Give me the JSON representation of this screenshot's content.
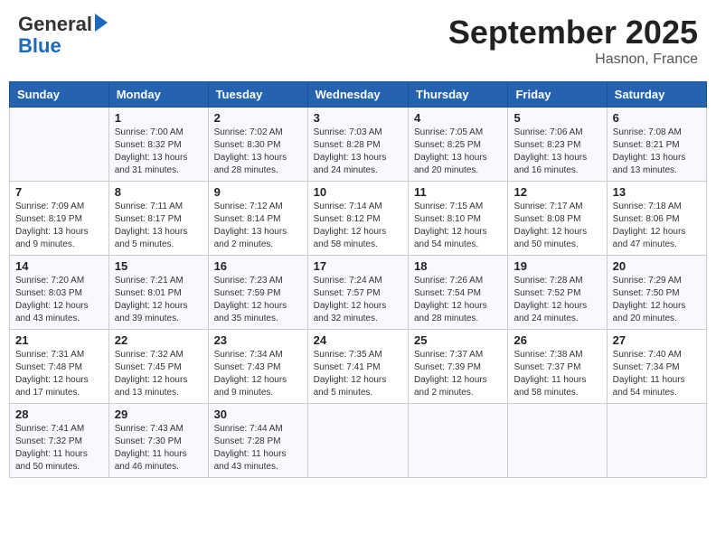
{
  "header": {
    "logo_line1": "General",
    "logo_line2": "Blue",
    "month": "September 2025",
    "location": "Hasnon, France"
  },
  "weekdays": [
    "Sunday",
    "Monday",
    "Tuesday",
    "Wednesday",
    "Thursday",
    "Friday",
    "Saturday"
  ],
  "weeks": [
    [
      {
        "day": "",
        "info": ""
      },
      {
        "day": "1",
        "info": "Sunrise: 7:00 AM\nSunset: 8:32 PM\nDaylight: 13 hours\nand 31 minutes."
      },
      {
        "day": "2",
        "info": "Sunrise: 7:02 AM\nSunset: 8:30 PM\nDaylight: 13 hours\nand 28 minutes."
      },
      {
        "day": "3",
        "info": "Sunrise: 7:03 AM\nSunset: 8:28 PM\nDaylight: 13 hours\nand 24 minutes."
      },
      {
        "day": "4",
        "info": "Sunrise: 7:05 AM\nSunset: 8:25 PM\nDaylight: 13 hours\nand 20 minutes."
      },
      {
        "day": "5",
        "info": "Sunrise: 7:06 AM\nSunset: 8:23 PM\nDaylight: 13 hours\nand 16 minutes."
      },
      {
        "day": "6",
        "info": "Sunrise: 7:08 AM\nSunset: 8:21 PM\nDaylight: 13 hours\nand 13 minutes."
      }
    ],
    [
      {
        "day": "7",
        "info": "Sunrise: 7:09 AM\nSunset: 8:19 PM\nDaylight: 13 hours\nand 9 minutes."
      },
      {
        "day": "8",
        "info": "Sunrise: 7:11 AM\nSunset: 8:17 PM\nDaylight: 13 hours\nand 5 minutes."
      },
      {
        "day": "9",
        "info": "Sunrise: 7:12 AM\nSunset: 8:14 PM\nDaylight: 13 hours\nand 2 minutes."
      },
      {
        "day": "10",
        "info": "Sunrise: 7:14 AM\nSunset: 8:12 PM\nDaylight: 12 hours\nand 58 minutes."
      },
      {
        "day": "11",
        "info": "Sunrise: 7:15 AM\nSunset: 8:10 PM\nDaylight: 12 hours\nand 54 minutes."
      },
      {
        "day": "12",
        "info": "Sunrise: 7:17 AM\nSunset: 8:08 PM\nDaylight: 12 hours\nand 50 minutes."
      },
      {
        "day": "13",
        "info": "Sunrise: 7:18 AM\nSunset: 8:06 PM\nDaylight: 12 hours\nand 47 minutes."
      }
    ],
    [
      {
        "day": "14",
        "info": "Sunrise: 7:20 AM\nSunset: 8:03 PM\nDaylight: 12 hours\nand 43 minutes."
      },
      {
        "day": "15",
        "info": "Sunrise: 7:21 AM\nSunset: 8:01 PM\nDaylight: 12 hours\nand 39 minutes."
      },
      {
        "day": "16",
        "info": "Sunrise: 7:23 AM\nSunset: 7:59 PM\nDaylight: 12 hours\nand 35 minutes."
      },
      {
        "day": "17",
        "info": "Sunrise: 7:24 AM\nSunset: 7:57 PM\nDaylight: 12 hours\nand 32 minutes."
      },
      {
        "day": "18",
        "info": "Sunrise: 7:26 AM\nSunset: 7:54 PM\nDaylight: 12 hours\nand 28 minutes."
      },
      {
        "day": "19",
        "info": "Sunrise: 7:28 AM\nSunset: 7:52 PM\nDaylight: 12 hours\nand 24 minutes."
      },
      {
        "day": "20",
        "info": "Sunrise: 7:29 AM\nSunset: 7:50 PM\nDaylight: 12 hours\nand 20 minutes."
      }
    ],
    [
      {
        "day": "21",
        "info": "Sunrise: 7:31 AM\nSunset: 7:48 PM\nDaylight: 12 hours\nand 17 minutes."
      },
      {
        "day": "22",
        "info": "Sunrise: 7:32 AM\nSunset: 7:45 PM\nDaylight: 12 hours\nand 13 minutes."
      },
      {
        "day": "23",
        "info": "Sunrise: 7:34 AM\nSunset: 7:43 PM\nDaylight: 12 hours\nand 9 minutes."
      },
      {
        "day": "24",
        "info": "Sunrise: 7:35 AM\nSunset: 7:41 PM\nDaylight: 12 hours\nand 5 minutes."
      },
      {
        "day": "25",
        "info": "Sunrise: 7:37 AM\nSunset: 7:39 PM\nDaylight: 12 hours\nand 2 minutes."
      },
      {
        "day": "26",
        "info": "Sunrise: 7:38 AM\nSunset: 7:37 PM\nDaylight: 11 hours\nand 58 minutes."
      },
      {
        "day": "27",
        "info": "Sunrise: 7:40 AM\nSunset: 7:34 PM\nDaylight: 11 hours\nand 54 minutes."
      }
    ],
    [
      {
        "day": "28",
        "info": "Sunrise: 7:41 AM\nSunset: 7:32 PM\nDaylight: 11 hours\nand 50 minutes."
      },
      {
        "day": "29",
        "info": "Sunrise: 7:43 AM\nSunset: 7:30 PM\nDaylight: 11 hours\nand 46 minutes."
      },
      {
        "day": "30",
        "info": "Sunrise: 7:44 AM\nSunset: 7:28 PM\nDaylight: 11 hours\nand 43 minutes."
      },
      {
        "day": "",
        "info": ""
      },
      {
        "day": "",
        "info": ""
      },
      {
        "day": "",
        "info": ""
      },
      {
        "day": "",
        "info": ""
      }
    ]
  ]
}
